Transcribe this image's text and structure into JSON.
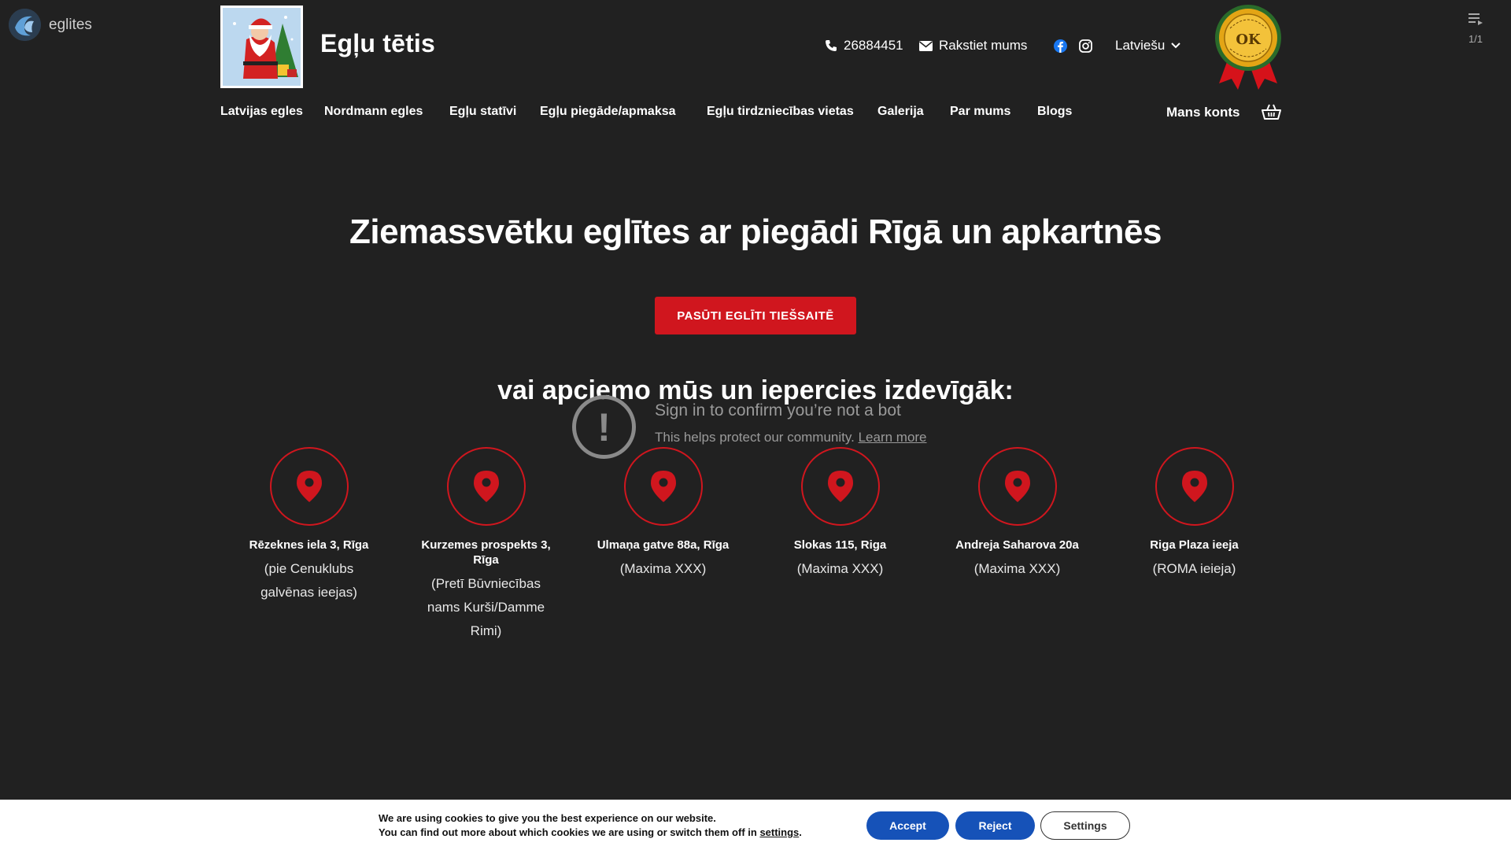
{
  "embed": {
    "channel_name": "eglites",
    "playlist_count": "1/1",
    "error_title": "Sign in to confirm you’re not a bot",
    "error_sub": "This helps protect our community.",
    "error_link": "Learn more"
  },
  "header": {
    "site_title": "Egļu tētis",
    "phone": "26884451",
    "email_label": "Rakstiet mums",
    "language": "Latviešu",
    "account": "Mans konts",
    "badge_text": "OK"
  },
  "nav": {
    "items": [
      {
        "label": "Latvijas egles"
      },
      {
        "label": "Nordmann egles"
      },
      {
        "label": "Egļu statīvi"
      },
      {
        "label": "Egļu piegāde/apmaksa"
      },
      {
        "label": "Egļu tirdzniecības vietas"
      },
      {
        "label": "Galerija"
      },
      {
        "label": "Par mums"
      },
      {
        "label": "Blogs"
      }
    ]
  },
  "hero": {
    "title": "Ziemassvētku eglītes ar piegādi Rīgā un apkartnēs",
    "cta": "PASŪTI EGLĪTI TIEŠSAITĒ",
    "subtitle": "vai apciemo mūs un iepercies izdevīgāk:"
  },
  "locations": [
    {
      "name": "Rēzeknes iela 3, Rīga",
      "note": "(pie Cenuklubs galvēnas ieejas)"
    },
    {
      "name": "Kurzemes prospekts 3, Rīga",
      "note": "(Pretī Būvniecības nams Kurši/Damme Rimi)"
    },
    {
      "name": "Ulmaņa gatve 88a, Rīga",
      "note": "(Maxima XXX)"
    },
    {
      "name": "Slokas 115, Riga",
      "note": "(Maxima XXX)"
    },
    {
      "name": "Andreja Saharova 20a",
      "note": "(Maxima XXX)"
    },
    {
      "name": "Riga Plaza ieeja",
      "note": "(ROMA ieieja)"
    }
  ],
  "cookie": {
    "line1": "We are using cookies to give you the best experience on our website.",
    "line2": "You can find out more about which cookies we are using or switch them off in",
    "link": "settings",
    "accept": "Accept",
    "reject": "Reject",
    "settings": "Settings"
  },
  "colors": {
    "background": "#212121",
    "accent_red": "#d0161e",
    "cookie_button_blue": "#1652b8"
  }
}
